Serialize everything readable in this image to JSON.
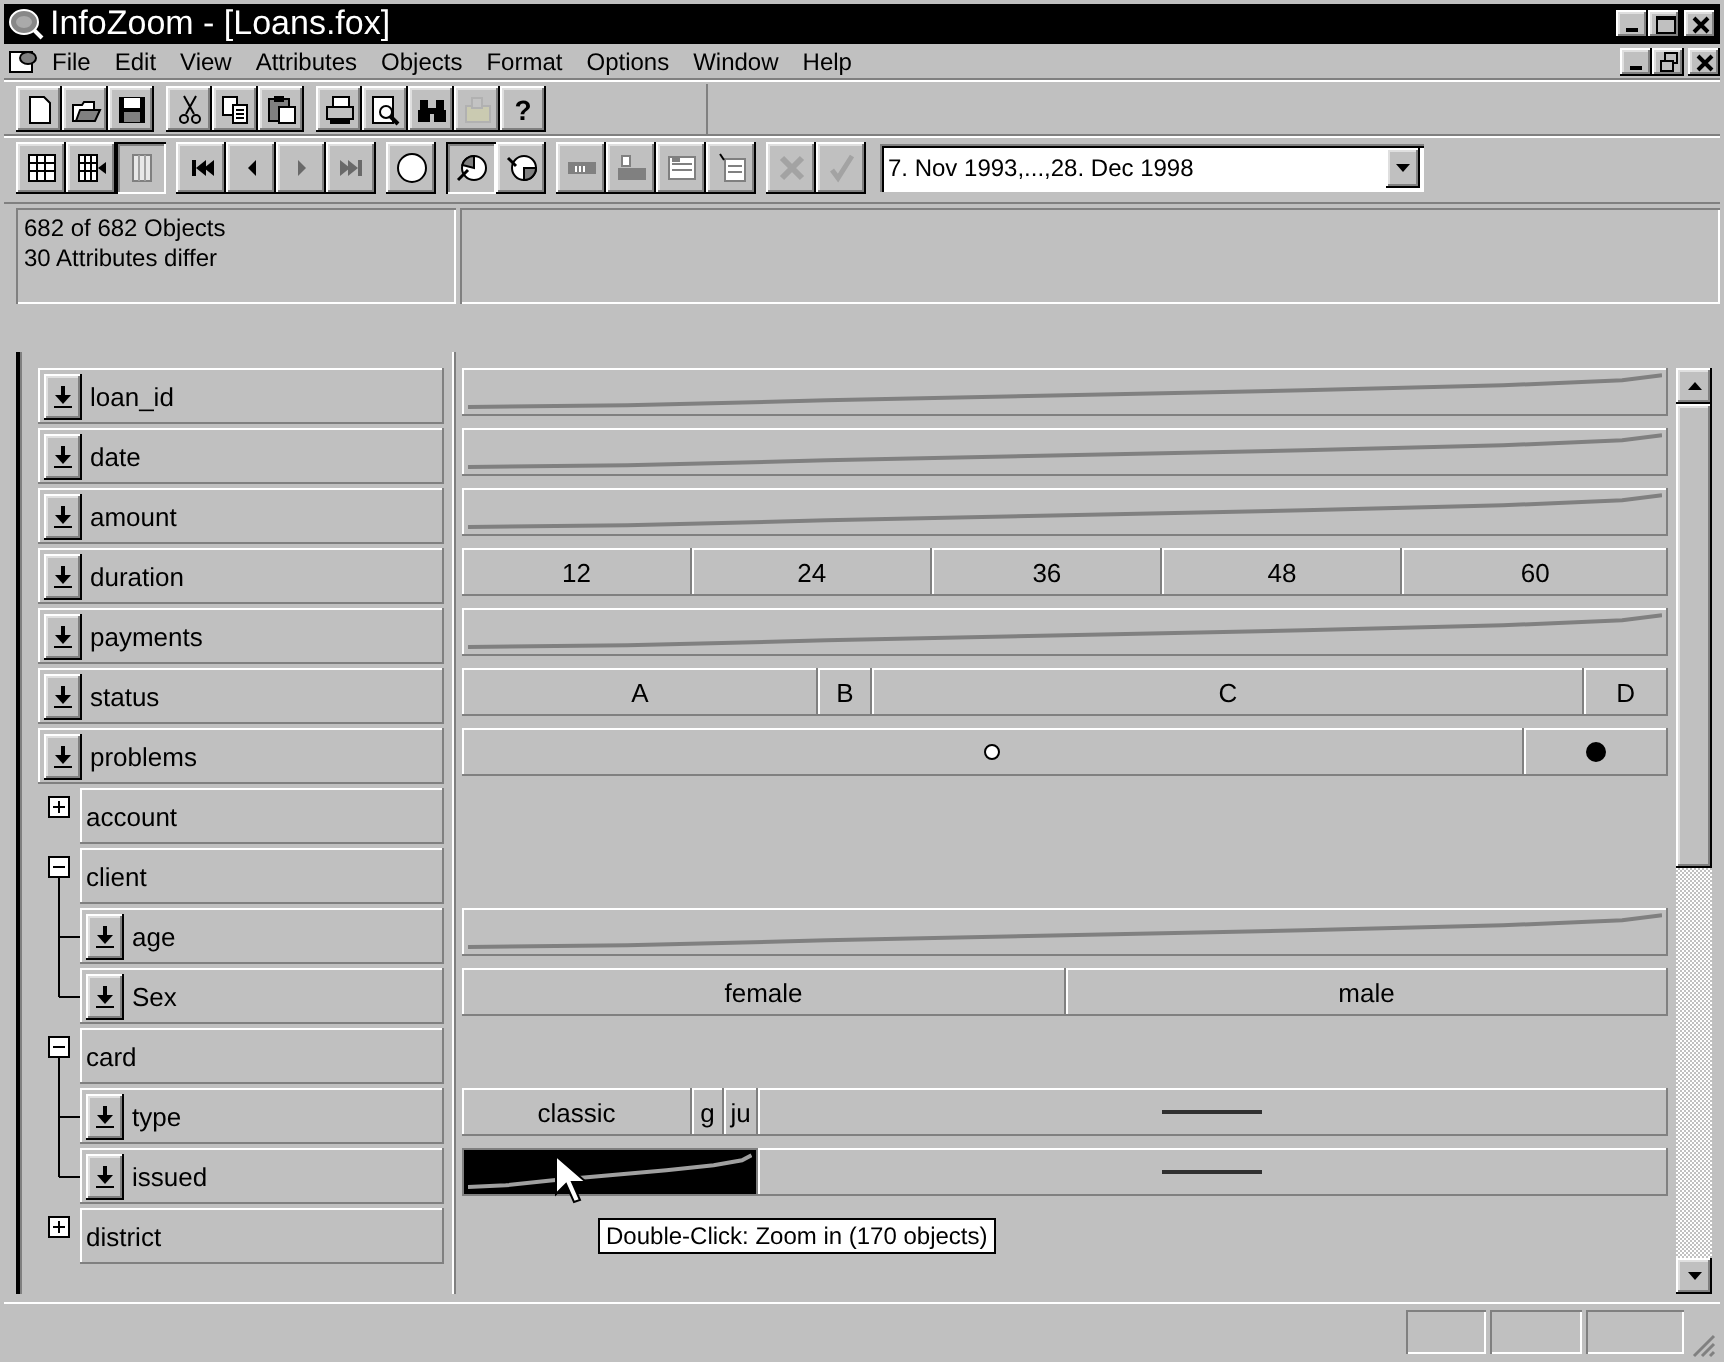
{
  "window": {
    "title": "InfoZoom - [Loans.fox]"
  },
  "menu": [
    "File",
    "Edit",
    "View",
    "Attributes",
    "Objects",
    "Format",
    "Options",
    "Window",
    "Help"
  ],
  "toolbar": [
    [
      {
        "kind": "new",
        "disabled": false
      },
      {
        "kind": "open",
        "disabled": false
      },
      {
        "kind": "save",
        "disabled": false
      }
    ],
    [
      {
        "kind": "cut",
        "disabled": false
      },
      {
        "kind": "copy",
        "disabled": false
      },
      {
        "kind": "paste",
        "disabled": false
      }
    ],
    [
      {
        "kind": "print",
        "disabled": false
      },
      {
        "kind": "preview",
        "disabled": false
      },
      {
        "kind": "find",
        "disabled": false
      },
      {
        "kind": "export",
        "disabled": true
      },
      {
        "kind": "help",
        "label": "?",
        "disabled": false
      }
    ]
  ],
  "view_toolbar": [
    [
      {
        "kind": "grid",
        "pressed": false,
        "disabled": false
      },
      {
        "kind": "grid-arrow",
        "pressed": false,
        "disabled": false
      },
      {
        "kind": "column",
        "pressed": true,
        "disabled": false
      }
    ],
    [
      {
        "kind": "first",
        "pressed": false,
        "disabled": false
      },
      {
        "kind": "prev",
        "pressed": false,
        "disabled": false
      },
      {
        "kind": "next",
        "pressed": false,
        "disabled": true
      },
      {
        "kind": "last",
        "pressed": false,
        "disabled": true
      }
    ],
    [
      {
        "kind": "circle",
        "pressed": false,
        "disabled": false
      }
    ],
    [
      {
        "kind": "pie-in",
        "pressed": true,
        "disabled": false
      },
      {
        "kind": "pie-out",
        "pressed": false,
        "disabled": false
      }
    ],
    [
      {
        "kind": "bar",
        "pressed": false,
        "disabled": false
      },
      {
        "kind": "card-a",
        "pressed": false,
        "disabled": false
      },
      {
        "kind": "card-b",
        "pressed": false,
        "disabled": false
      },
      {
        "kind": "card-c",
        "pressed": false,
        "disabled": false
      }
    ],
    [
      {
        "kind": "cancel",
        "pressed": false,
        "disabled": true
      },
      {
        "kind": "confirm",
        "pressed": false,
        "disabled": true
      }
    ]
  ],
  "date_range": {
    "value": "7. Nov 1993,...,28. Dec 1998"
  },
  "summary": {
    "objects": "682 of 682 Objects",
    "attributes": "30 Attributes differ"
  },
  "attributes": [
    {
      "kind": "attr",
      "name": "loan_id",
      "values": {
        "kind": "curve"
      }
    },
    {
      "kind": "attr",
      "name": "date",
      "values": {
        "kind": "curve"
      }
    },
    {
      "kind": "attr",
      "name": "amount",
      "values": {
        "kind": "curve"
      }
    },
    {
      "kind": "attr",
      "name": "duration",
      "values": {
        "kind": "segments",
        "segments": [
          {
            "kind": "text",
            "label": "12",
            "selected": false
          },
          {
            "kind": "text",
            "label": "24",
            "selected": false
          },
          {
            "kind": "text",
            "label": "36",
            "selected": false
          },
          {
            "kind": "text",
            "label": "48",
            "selected": false
          },
          {
            "kind": "text",
            "label": "60",
            "selected": false
          }
        ]
      }
    },
    {
      "kind": "attr",
      "name": "payments",
      "values": {
        "kind": "curve"
      }
    },
    {
      "kind": "attr",
      "name": "status",
      "values": {
        "kind": "segments",
        "segments": [
          {
            "kind": "text",
            "label": "A",
            "selected": false
          },
          {
            "kind": "text",
            "label": "B",
            "selected": false
          },
          {
            "kind": "text",
            "label": "C",
            "selected": false
          },
          {
            "kind": "text",
            "label": "D",
            "selected": false
          }
        ]
      }
    },
    {
      "kind": "attr",
      "name": "problems",
      "values": {
        "kind": "segments",
        "segments": [
          {
            "kind": "dot",
            "filled": false,
            "selected": false
          },
          {
            "kind": "dot",
            "filled": true,
            "selected": false
          }
        ]
      }
    },
    {
      "kind": "group",
      "name": "account",
      "expanded": false
    },
    {
      "kind": "group",
      "name": "client",
      "expanded": true,
      "children": [
        {
          "kind": "attr",
          "name": "age",
          "values": {
            "kind": "curve"
          }
        },
        {
          "kind": "attr",
          "name": "Sex",
          "values": {
            "kind": "segments",
            "segments": [
              {
                "kind": "text",
                "label": "female",
                "selected": false
              },
              {
                "kind": "text",
                "label": "male",
                "selected": false
              }
            ]
          }
        }
      ]
    },
    {
      "kind": "group",
      "name": "card",
      "expanded": true,
      "children": [
        {
          "kind": "attr",
          "name": "type",
          "values": {
            "kind": "segments",
            "segments": [
              {
                "kind": "text",
                "label": "classic",
                "selected": false
              },
              {
                "kind": "text",
                "label": "g",
                "selected": false
              },
              {
                "kind": "text",
                "label": "ju",
                "selected": false
              },
              {
                "kind": "dash",
                "selected": false
              }
            ]
          }
        },
        {
          "kind": "attr",
          "name": "issued",
          "values": {
            "kind": "segments",
            "segments": [
              {
                "kind": "curve",
                "selected": true
              },
              {
                "kind": "dash",
                "selected": false
              }
            ]
          }
        }
      ]
    },
    {
      "kind": "group",
      "name": "district",
      "expanded": false
    }
  ],
  "tooltip": "Double-Click: Zoom in (170 objects)"
}
